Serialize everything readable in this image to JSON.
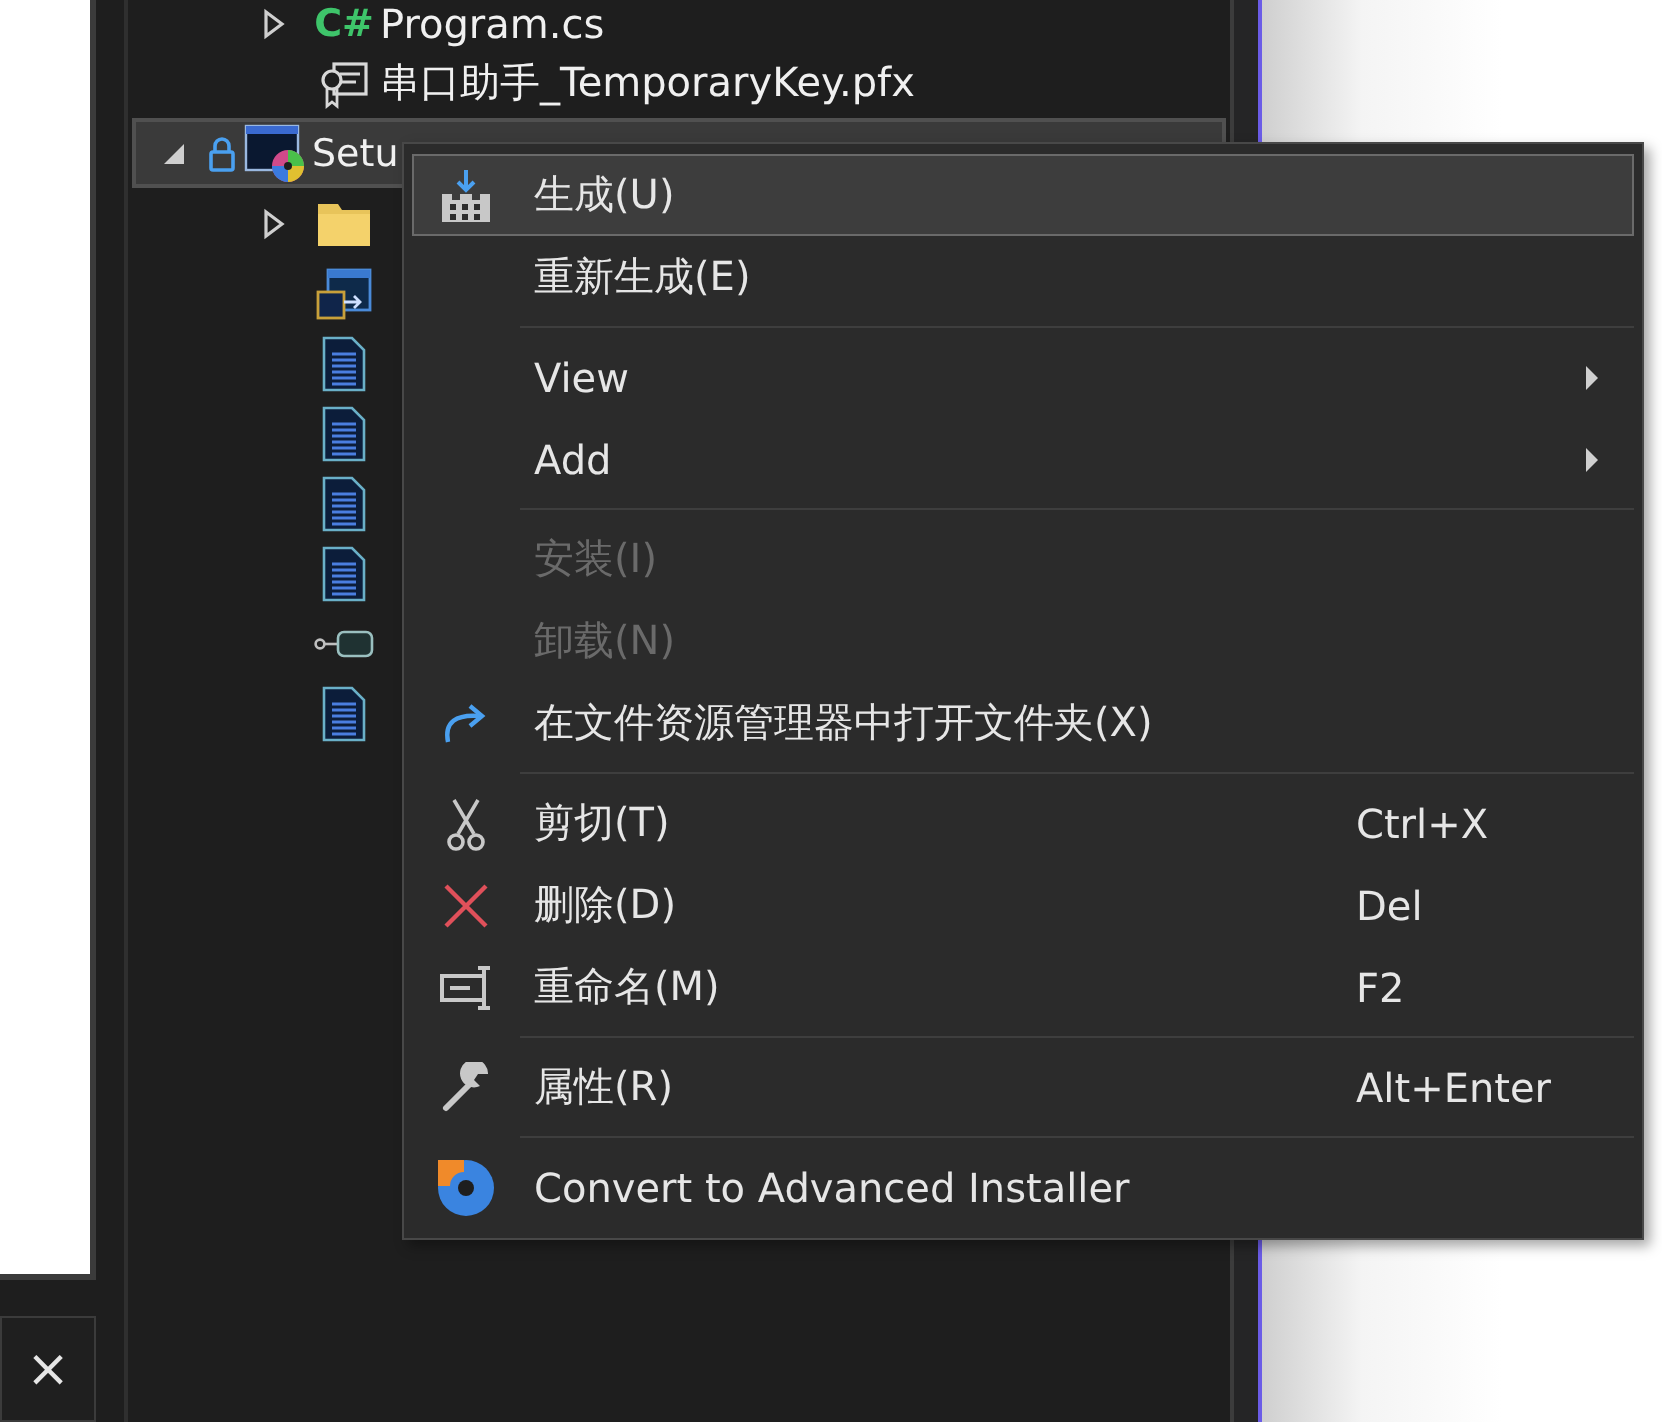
{
  "project_items": [
    {
      "label": "Program.cs",
      "kind": "csharp",
      "badge": "C#",
      "expanded": false
    },
    {
      "label": "串口助手_TemporaryKey.pfx",
      "kind": "certificate"
    }
  ],
  "setup_project": {
    "label": "Setu",
    "expanded": true,
    "selected": true,
    "children": [
      {
        "kind": "folder",
        "expanded": false
      },
      {
        "kind": "window"
      },
      {
        "kind": "document"
      },
      {
        "kind": "document"
      },
      {
        "kind": "document"
      },
      {
        "kind": "document"
      },
      {
        "kind": "connector"
      },
      {
        "kind": "document"
      }
    ]
  },
  "context_menu": {
    "groups": [
      [
        {
          "label": "生成(U)",
          "kind": "build",
          "selected": true,
          "disabled": false
        },
        {
          "label": "重新生成(E)",
          "kind": "plain",
          "selected": false,
          "disabled": false
        }
      ],
      [
        {
          "label": "View",
          "kind": "submenu",
          "selected": false,
          "disabled": false
        },
        {
          "label": "Add",
          "kind": "submenu",
          "selected": false,
          "disabled": false
        }
      ],
      [
        {
          "label": "安装(I)",
          "kind": "plain",
          "selected": false,
          "disabled": true
        },
        {
          "label": "卸载(N)",
          "kind": "plain",
          "selected": false,
          "disabled": true
        },
        {
          "label": "在文件资源管理器中打开文件夹(X)",
          "kind": "open",
          "selected": false,
          "disabled": false
        }
      ],
      [
        {
          "label": "剪切(T)",
          "kind": "cut",
          "shortcut": "Ctrl+X",
          "selected": false,
          "disabled": false
        },
        {
          "label": "删除(D)",
          "kind": "delete",
          "shortcut": "Del",
          "selected": false,
          "disabled": false
        },
        {
          "label": "重命名(M)",
          "kind": "rename",
          "shortcut": "F2",
          "selected": false,
          "disabled": false
        }
      ],
      [
        {
          "label": "属性(R)",
          "kind": "properties",
          "shortcut": "Alt+Enter",
          "selected": false,
          "disabled": false
        }
      ],
      [
        {
          "label": "Convert to Advanced Installer",
          "kind": "addon",
          "selected": false,
          "disabled": false
        }
      ]
    ]
  },
  "bottom_tab": {
    "close": "×"
  }
}
